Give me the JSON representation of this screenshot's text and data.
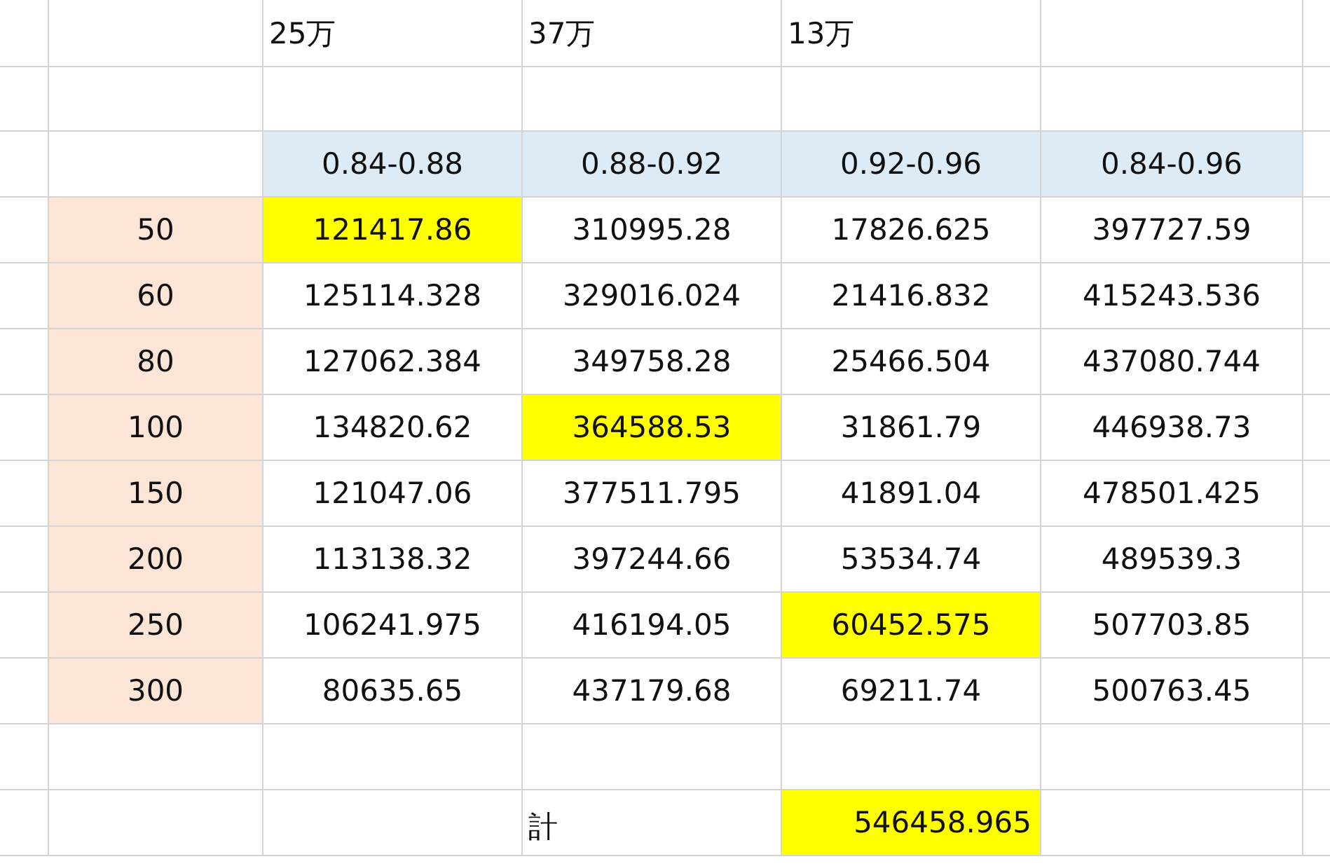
{
  "top_labels": [
    "25万",
    "37万",
    "13万"
  ],
  "ranges": [
    "0.84-0.88",
    "0.88-0.92",
    "0.92-0.96",
    "0.84-0.96"
  ],
  "rows": [
    {
      "label": "50",
      "values": [
        {
          "text": "121417.86",
          "highlighted": true
        },
        {
          "text": "310995.28",
          "highlighted": false
        },
        {
          "text": "17826.625",
          "highlighted": false
        },
        {
          "text": "397727.59",
          "highlighted": false
        }
      ]
    },
    {
      "label": "60",
      "values": [
        {
          "text": "125114.328",
          "highlighted": false
        },
        {
          "text": "329016.024",
          "highlighted": false
        },
        {
          "text": "21416.832",
          "highlighted": false
        },
        {
          "text": "415243.536",
          "highlighted": false
        }
      ]
    },
    {
      "label": "80",
      "values": [
        {
          "text": "127062.384",
          "highlighted": false
        },
        {
          "text": "349758.28",
          "highlighted": false
        },
        {
          "text": "25466.504",
          "highlighted": false
        },
        {
          "text": "437080.744",
          "highlighted": false
        }
      ]
    },
    {
      "label": "100",
      "values": [
        {
          "text": "134820.62",
          "highlighted": false
        },
        {
          "text": "364588.53",
          "highlighted": true
        },
        {
          "text": "31861.79",
          "highlighted": false
        },
        {
          "text": "446938.73",
          "highlighted": false
        }
      ]
    },
    {
      "label": "150",
      "values": [
        {
          "text": "121047.06",
          "highlighted": false
        },
        {
          "text": "377511.795",
          "highlighted": false
        },
        {
          "text": "41891.04",
          "highlighted": false
        },
        {
          "text": "478501.425",
          "highlighted": false
        }
      ]
    },
    {
      "label": "200",
      "values": [
        {
          "text": "113138.32",
          "highlighted": false
        },
        {
          "text": "397244.66",
          "highlighted": false
        },
        {
          "text": "53534.74",
          "highlighted": false
        },
        {
          "text": "489539.3",
          "highlighted": false
        }
      ]
    },
    {
      "label": "250",
      "values": [
        {
          "text": "106241.975",
          "highlighted": false
        },
        {
          "text": "416194.05",
          "highlighted": false
        },
        {
          "text": "60452.575",
          "highlighted": true
        },
        {
          "text": "507703.85",
          "highlighted": false
        }
      ]
    },
    {
      "label": "300",
      "values": [
        {
          "text": "80635.65",
          "highlighted": false
        },
        {
          "text": "437179.68",
          "highlighted": false
        },
        {
          "text": "69211.74",
          "highlighted": false
        },
        {
          "text": "500763.45",
          "highlighted": false
        }
      ]
    }
  ],
  "total": {
    "label": "計",
    "value": "546458.965",
    "highlighted": true
  }
}
